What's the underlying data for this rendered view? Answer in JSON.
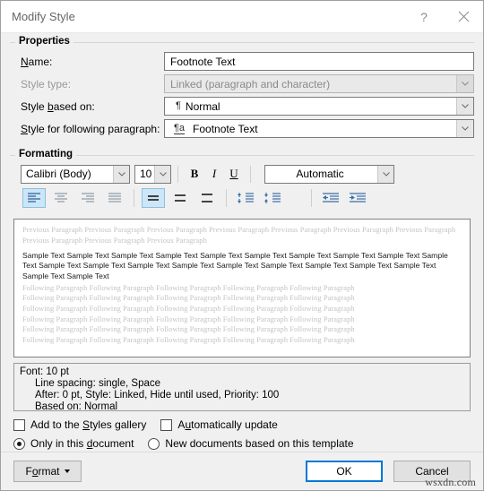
{
  "window": {
    "title": "Modify Style",
    "help_label": "?",
    "close_label": "✕"
  },
  "properties": {
    "group_label": "Properties",
    "name": {
      "label": "Name:",
      "label_accel": "N",
      "value": "Footnote Text"
    },
    "style_type": {
      "label": "Style type:",
      "value": "Linked (paragraph and character)",
      "disabled": true
    },
    "style_based_on": {
      "label": "Style based on:",
      "label_accel": "b",
      "icon": "pilcrow-icon",
      "icon_glyph": "¶",
      "value": "Normal"
    },
    "style_following": {
      "label": "Style for following paragraph:",
      "label_accel": "S",
      "icon": "linked-style-icon",
      "icon_glyph": "¶a",
      "value": "Footnote Text"
    }
  },
  "formatting": {
    "group_label": "Formatting",
    "font_family": "Calibri (Body)",
    "font_size": "10",
    "bold_label": "B",
    "italic_label": "I",
    "underline_label": "U",
    "font_color": "Automatic",
    "align_buttons": [
      {
        "name": "align-left-button",
        "active": true
      },
      {
        "name": "align-center-button",
        "active": false
      },
      {
        "name": "align-right-button",
        "active": false
      },
      {
        "name": "align-justify-button",
        "active": false
      }
    ],
    "linespacing_buttons": [
      {
        "name": "line-spacing-single-button",
        "active": true
      },
      {
        "name": "line-spacing-1-5-button",
        "active": false
      },
      {
        "name": "line-spacing-double-button",
        "active": false
      }
    ],
    "space_buttons": [
      {
        "name": "increase-paragraph-spacing-button",
        "active": false
      },
      {
        "name": "decrease-paragraph-spacing-button",
        "active": false
      }
    ],
    "indent_buttons": [
      {
        "name": "decrease-indent-button",
        "active": false
      },
      {
        "name": "increase-indent-button",
        "active": false
      }
    ]
  },
  "preview": {
    "previous_paragraph": "Previous Paragraph Previous Paragraph Previous Paragraph Previous Paragraph Previous Paragraph Previous Paragraph Previous Paragraph Previous Paragraph Previous Paragraph Previous Paragraph",
    "sample_text": "Sample Text Sample Text Sample Text Sample Text Sample Text Sample Text Sample Text Sample Text Sample Text Sample Text Sample Text Sample Text Sample Text Sample Text Sample Text Sample Text Sample Text Sample Text Sample Text Sample Text Sample Text",
    "following_paragraph_line": "Following Paragraph Following Paragraph Following Paragraph Following Paragraph Following Paragraph",
    "following_paragraph_lines": 6
  },
  "description": {
    "line1": "Font: 10 pt",
    "line2": "Line spacing:  single, Space",
    "line3": "After:  0 pt, Style: Linked, Hide until used, Priority: 100",
    "line4": "Based on: Normal"
  },
  "options": {
    "add_to_gallery": {
      "label": "Add to the Styles gallery",
      "checked": false
    },
    "automatically_update": {
      "label": "Automatically update",
      "checked": false
    },
    "only_this_document": {
      "label": "Only in this document",
      "checked": true
    },
    "new_documents": {
      "label": "New documents based on this template",
      "checked": false
    }
  },
  "buttons": {
    "format": "Format",
    "ok": "OK",
    "cancel": "Cancel"
  },
  "watermark": "wsxdn.com",
  "colors": {
    "accent": "#0078d7",
    "toolbar_icon": "#3b6ea5",
    "active_button_bg": "#cde6f7",
    "dialog_bg": "#f0f0f0",
    "preview_gray": "#c3c3c3"
  }
}
